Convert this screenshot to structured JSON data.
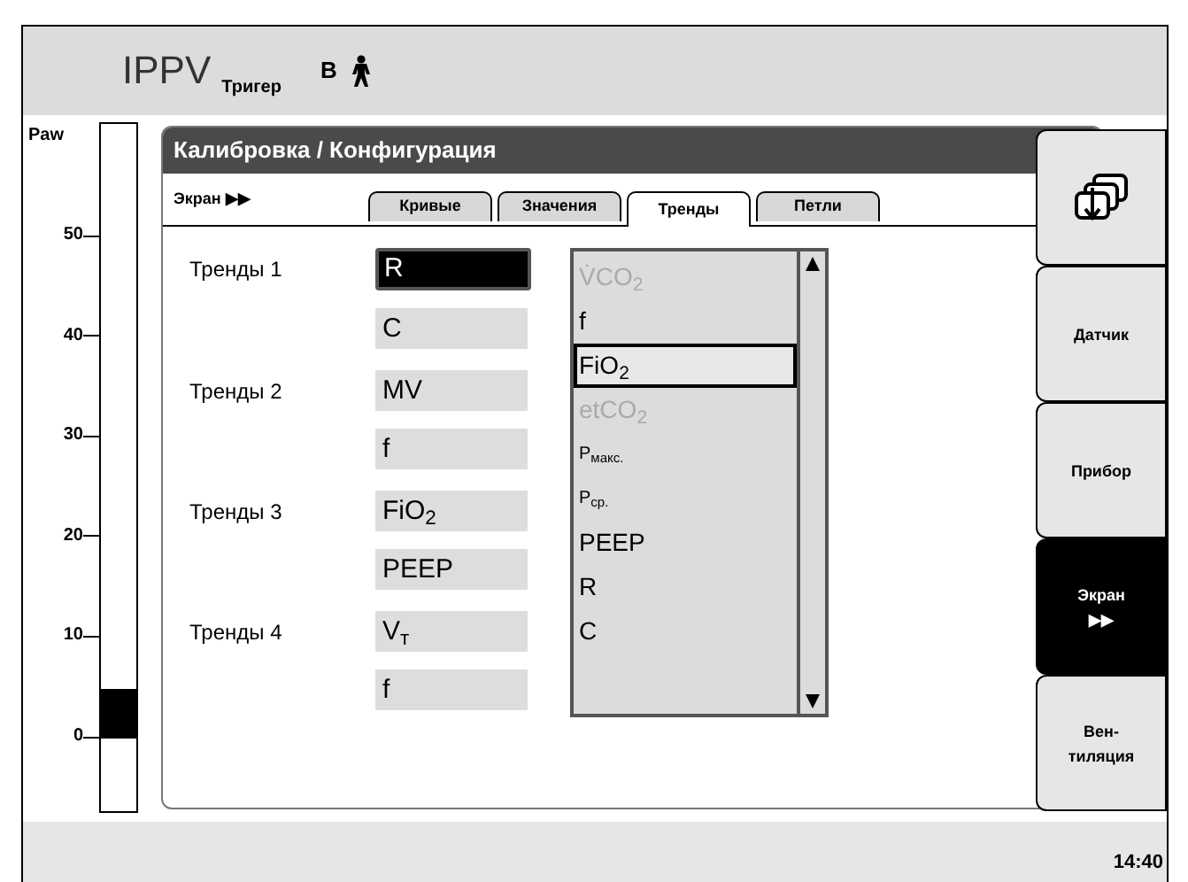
{
  "header": {
    "mode": "IPPV",
    "mode_sub": "Тригер",
    "patient_type": "B"
  },
  "pressure_gauge": {
    "label": "Paw",
    "ticks": [
      "50",
      "40",
      "30",
      "20",
      "10",
      "0"
    ],
    "level": 0.1
  },
  "panel": {
    "title": "Калибровка / Конфигурация",
    "screen_label": "Экран ▶▶",
    "tabs": [
      {
        "label": "Кривые",
        "selected": false
      },
      {
        "label": "Значения",
        "selected": false
      },
      {
        "label": "Тренды",
        "selected": true
      },
      {
        "label": "Петли",
        "selected": false
      }
    ],
    "trends": [
      {
        "label": "Тренды 1",
        "fields": [
          {
            "value": "R",
            "focused": true
          },
          {
            "value": "C",
            "focused": false
          }
        ]
      },
      {
        "label": "Тренды 2",
        "fields": [
          {
            "value": "MV",
            "focused": false
          },
          {
            "value": "f",
            "focused": false
          }
        ]
      },
      {
        "label": "Тренды 3",
        "fields": [
          {
            "value": "FiO$_{2}$",
            "focused": false
          },
          {
            "value": "PEEP",
            "focused": false
          }
        ]
      },
      {
        "label": "Тренды 4",
        "fields": [
          {
            "value": "V$_{т}$",
            "focused": false
          },
          {
            "value": "f",
            "focused": false
          }
        ]
      }
    ],
    "parameter_list": [
      {
        "label": "V̇CO$_{2}$",
        "disabled": true,
        "selected": false,
        "kind": "large"
      },
      {
        "label": "f",
        "disabled": false,
        "selected": false,
        "kind": "large"
      },
      {
        "label": "FiO$_{2}$",
        "disabled": false,
        "selected": true,
        "kind": "large"
      },
      {
        "label": "etCO$_{2}$",
        "disabled": true,
        "selected": false,
        "kind": "large"
      },
      {
        "label": "P$_{макс.}$",
        "disabled": false,
        "selected": false,
        "kind": "small"
      },
      {
        "label": "P$_{ср.}$",
        "disabled": false,
        "selected": false,
        "kind": "small"
      },
      {
        "label": "PEEP",
        "disabled": false,
        "selected": false,
        "kind": "large"
      },
      {
        "label": "R",
        "disabled": false,
        "selected": false,
        "kind": "large"
      },
      {
        "label": "C",
        "disabled": false,
        "selected": false,
        "kind": "large"
      }
    ]
  },
  "side_buttons": [
    {
      "kind": "icon",
      "selected": false
    },
    {
      "kind": "text",
      "label": "Датчик",
      "selected": false
    },
    {
      "kind": "text",
      "label": "Прибор",
      "selected": false
    },
    {
      "kind": "text",
      "label": "Экран\n▶▶",
      "selected": true
    },
    {
      "kind": "text",
      "label": "Вен-\nтиляция",
      "selected": false
    }
  ],
  "status_bar": {
    "time": "14:40"
  }
}
